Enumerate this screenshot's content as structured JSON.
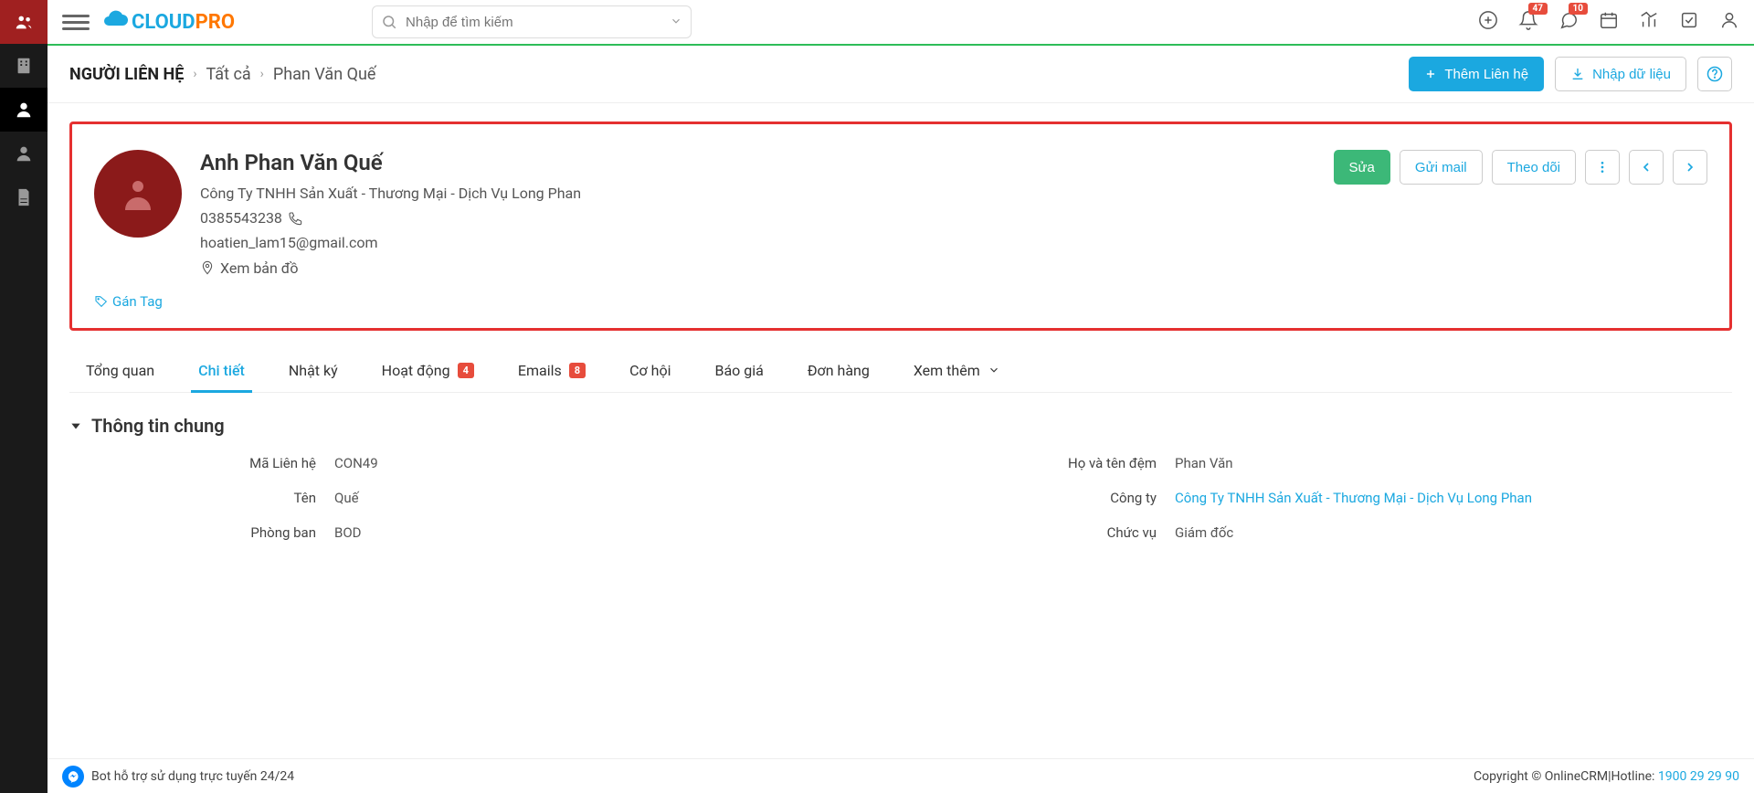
{
  "topbar": {
    "search_placeholder": "Nhập để tìm kiếm",
    "badge_notifications": "47",
    "badge_messages": "10"
  },
  "breadcrumb": {
    "title": "NGƯỜI LIÊN HỆ",
    "link1": "Tất cả",
    "link2": "Phan Văn Quế"
  },
  "actions": {
    "add": "Thêm Liên hệ",
    "import": "Nhập dữ liệu"
  },
  "profile": {
    "name": "Anh Phan Văn Quế",
    "company": "Công Ty TNHH Sản Xuất - Thương Mại - Dịch Vụ Long Phan",
    "phone": "0385543238",
    "email": "hoatien_lam15@gmail.com",
    "map": "Xem bản đồ",
    "tag": "Gán Tag"
  },
  "profile_actions": {
    "edit": "Sửa",
    "send_mail": "Gửi mail",
    "follow": "Theo dõi"
  },
  "tabs": {
    "overview": "Tổng quan",
    "detail": "Chi tiết",
    "journal": "Nhật ký",
    "activity": "Hoạt động",
    "activity_badge": "4",
    "emails": "Emails",
    "emails_badge": "8",
    "opportunity": "Cơ hội",
    "quote": "Báo giá",
    "order": "Đơn hàng",
    "more": "Xem thêm"
  },
  "section": {
    "title": "Thông tin chung"
  },
  "fields": {
    "code_label": "Mã Liên hệ",
    "code_value": "CON49",
    "lastname_label": "Họ và tên đệm",
    "lastname_value": "Phan Văn",
    "firstname_label": "Tên",
    "firstname_value": "Quế",
    "company_label": "Công ty",
    "company_value": "Công Ty TNHH Sản Xuất - Thương Mại - Dịch Vụ Long Phan",
    "dept_label": "Phòng ban",
    "dept_value": "BOD",
    "position_label": "Chức vụ",
    "position_value": "Giám đốc"
  },
  "footer": {
    "bot": "Bot hỗ trợ sử dụng trực tuyến 24/24",
    "copyright": "Copyright © OnlineCRM|Hotline: ",
    "hotline": "1900 29 29 90"
  }
}
